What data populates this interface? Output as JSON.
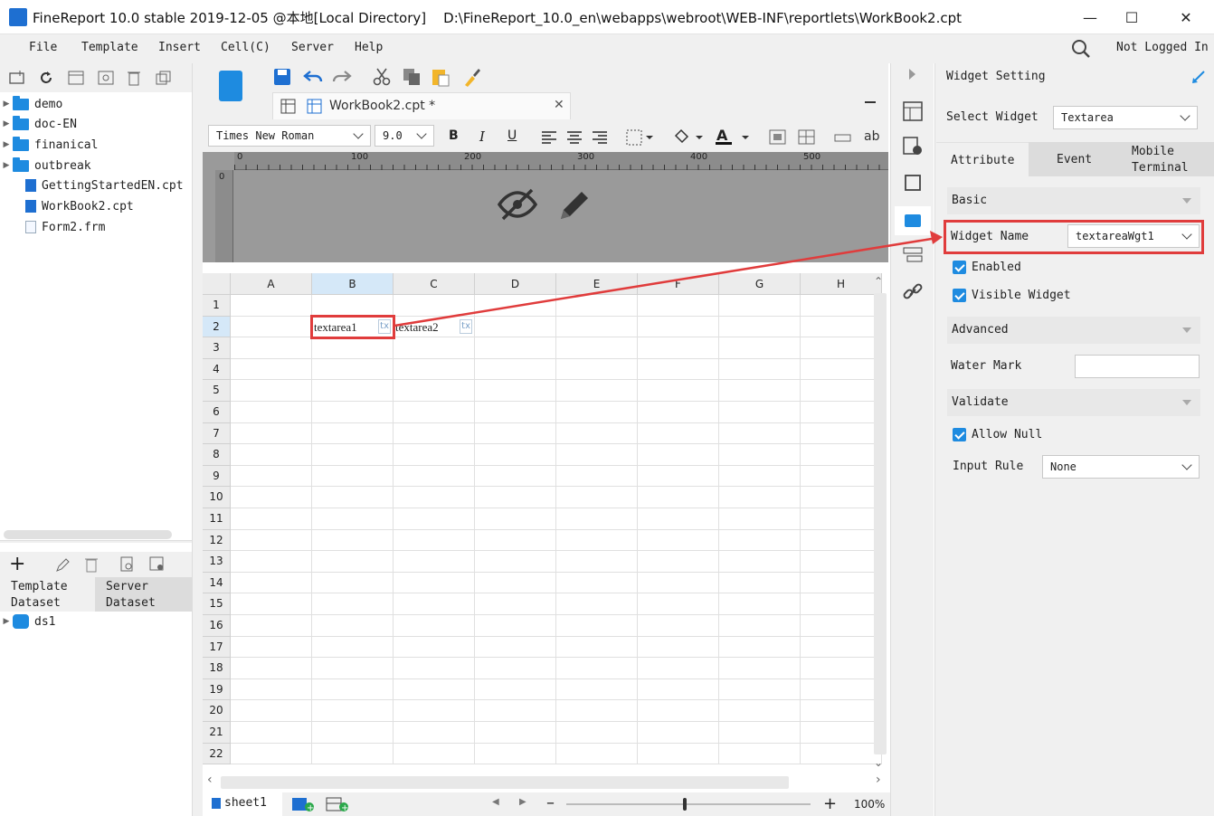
{
  "window": {
    "title": "FineReport 10.0 stable 2019-12-05 @本地[Local Directory]    D:\\FineReport_10.0_en\\webapps\\webroot\\WEB-INF\\reportlets\\WorkBook2.cpt"
  },
  "menu": {
    "items": [
      "File",
      "Template",
      "Insert",
      "Cell(C)",
      "Server",
      "Help"
    ],
    "login": "Not Logged In"
  },
  "tree": {
    "items": [
      {
        "label": "demo",
        "type": "folder"
      },
      {
        "label": "doc-EN",
        "type": "folder"
      },
      {
        "label": "finanical",
        "type": "folder"
      },
      {
        "label": "outbreak",
        "type": "folder"
      },
      {
        "label": "GettingStartedEN.cpt",
        "type": "cpt"
      },
      {
        "label": "WorkBook2.cpt",
        "type": "cpt"
      },
      {
        "label": "Form2.frm",
        "type": "frm"
      }
    ]
  },
  "dataset": {
    "tab_template": "Template\nDataset",
    "tab_server": "Server\nDataset",
    "items": [
      "ds1"
    ]
  },
  "editor": {
    "tab_title": "WorkBook2.cpt *",
    "font_name": "Times New Roman",
    "font_size": "9.0",
    "ruler_ticks": [
      "0",
      "100",
      "200",
      "300",
      "400",
      "500"
    ],
    "vruler": "0"
  },
  "grid": {
    "columns": [
      "A",
      "B",
      "C",
      "D",
      "E",
      "F",
      "G",
      "H"
    ],
    "rows": [
      "1",
      "2",
      "3",
      "4",
      "5",
      "6",
      "7",
      "8",
      "9",
      "10",
      "11",
      "12",
      "13",
      "14",
      "15",
      "16",
      "17",
      "18",
      "19",
      "20",
      "21",
      "22"
    ],
    "cell_b2": "textarea1",
    "cell_c2": "textarea2",
    "widget_tag": "tx"
  },
  "status": {
    "sheet": "sheet1",
    "zoom": "100%"
  },
  "panel": {
    "header": "Widget Setting",
    "select_widget_label": "Select Widget",
    "select_widget_value": "Textarea",
    "tabs": [
      "Attribute",
      "Event",
      "Mobile\nTerminal"
    ],
    "section_basic": "Basic",
    "widget_name_label": "Widget Name",
    "widget_name_value": "textareaWgt1",
    "enabled_label": "Enabled",
    "visible_label": "Visible Widget",
    "section_advanced": "Advanced",
    "water_mark_label": "Water Mark",
    "water_mark_value": "",
    "section_validate": "Validate",
    "allow_null_label": "Allow Null",
    "input_rule_label": "Input Rule",
    "input_rule_value": "None"
  },
  "colors": {
    "accent": "#1e8be0",
    "highlight": "#e03c3c",
    "selected_col": "#d5e8f8"
  }
}
